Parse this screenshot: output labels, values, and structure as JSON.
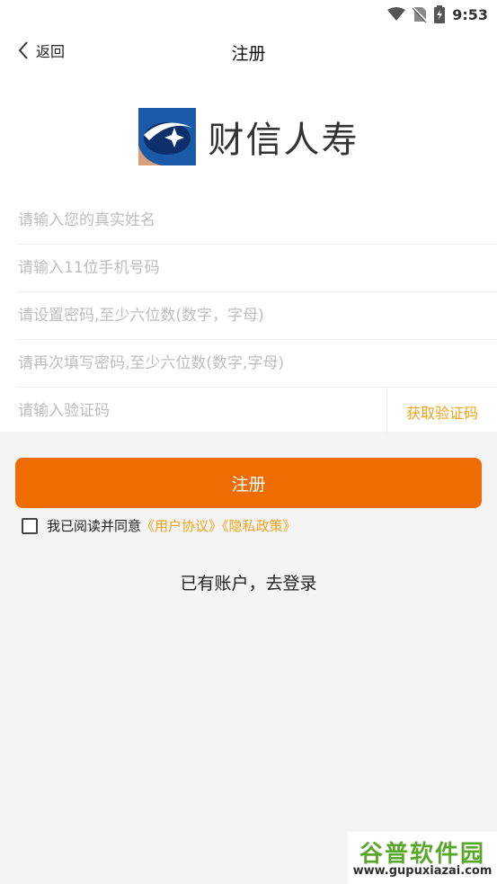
{
  "status_bar": {
    "time": "9:53",
    "icons": [
      "wifi-icon",
      "no-sim-icon",
      "battery-charging-icon"
    ]
  },
  "header": {
    "back_label": "返回",
    "title": "注册"
  },
  "logo": {
    "text": "财信人寿",
    "colors": {
      "blue": "#1a5aa6",
      "dark_blue": "#0d2f6b",
      "tan": "#d8a07a"
    }
  },
  "form": {
    "name_placeholder": "请输入您的真实姓名",
    "phone_placeholder": "请输入11位手机号码",
    "password_placeholder": "请设置密码,至少六位数(数字，字母)",
    "confirm_placeholder": "请再次填写密码,至少六位数(数字,字母)",
    "code_placeholder": "请输入验证码",
    "get_code_label": "获取验证码"
  },
  "register_label": "注册",
  "agreement": {
    "prefix": "我已阅读并同意",
    "user_agreement": "《用户协议》",
    "privacy_policy": "《隐私政策》",
    "checked": false
  },
  "login_link": "已有账户，去登录",
  "watermark": {
    "title": "谷普软件园",
    "url": "www.gupuxiazai.com"
  },
  "colors": {
    "accent": "#ee6c02",
    "link": "#f0a318",
    "background": "#f4f4f4"
  }
}
